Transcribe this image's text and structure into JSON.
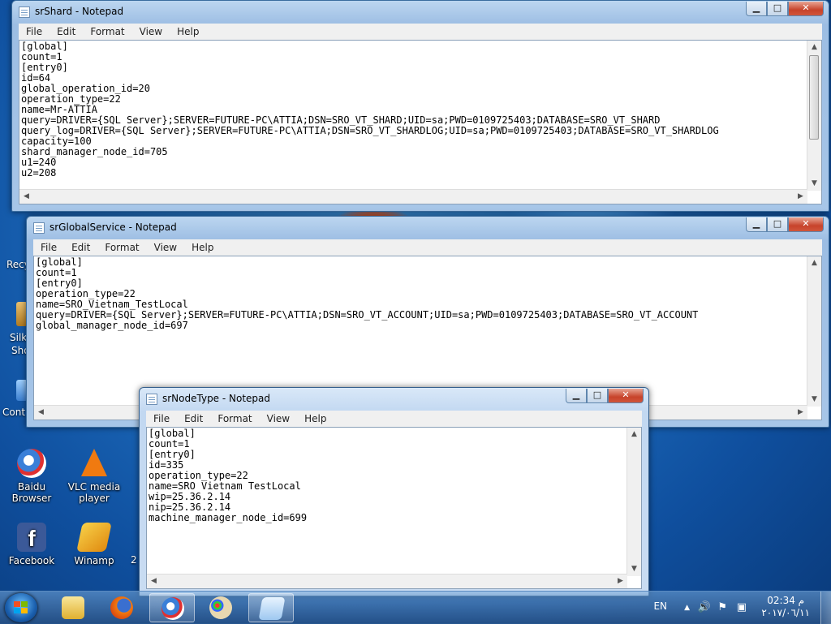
{
  "desktop": {
    "icons": [
      {
        "label": "Baidu Browser",
        "line1": "Baidu",
        "line2": "Browser",
        "icon": "baidu-browser-icon"
      },
      {
        "label": "VLC media player",
        "line1": "VLC media",
        "line2": "player",
        "icon": "vlc-icon"
      },
      {
        "label": "Facebook",
        "line1": "Facebook",
        "line2": "",
        "icon": "facebook-icon"
      },
      {
        "label": "Winamp",
        "line1": "Winamp",
        "line2": "",
        "icon": "winamp-icon"
      }
    ],
    "partial_labels": {
      "recycle": "Recy",
      "silk1": "Silk",
      "silk2": "Sho",
      "control": "Cont",
      "two": "2"
    }
  },
  "menu": [
    "File",
    "Edit",
    "Format",
    "View",
    "Help"
  ],
  "windows": {
    "shard": {
      "title": "srShard - Notepad",
      "content": "[global]\ncount=1\n[entry0]\nid=64\nglobal_operation_id=20\noperation_type=22\nname=Mr-ATTIA\nquery=DRIVER={SQL Server};SERVER=FUTURE-PC\\ATTIA;DSN=SRO_VT_SHARD;UID=sa;PWD=0109725403;DATABASE=SRO_VT_SHARD\nquery_log=DRIVER={SQL Server};SERVER=FUTURE-PC\\ATTIA;DSN=SRO_VT_SHARDLOG;UID=sa;PWD=0109725403;DATABASE=SRO_VT_SHARDLOG\ncapacity=100\nshard_manager_node_id=705\nu1=240\nu2=208"
    },
    "global": {
      "title": "srGlobalService - Notepad",
      "content": "[global]\ncount=1\n[entry0]\noperation_type=22\nname=SRO_Vietnam_TestLocal\nquery=DRIVER={SQL Server};SERVER=FUTURE-PC\\ATTIA;DSN=SRO_VT_ACCOUNT;UID=sa;PWD=0109725403;DATABASE=SRO_VT_ACCOUNT\nglobal_manager_node_id=697"
    },
    "node": {
      "title": "srNodeType - Notepad",
      "content": "[global]\ncount=1\n[entry0]\nid=335\noperation_type=22\nname=SRO Vietnam TestLocal\nwip=25.36.2.14\nnip=25.36.2.14\nmachine_manager_node_id=699"
    }
  },
  "window_buttons": {
    "minimize": "▁",
    "maximize": "□",
    "close": "✕"
  },
  "taskbar": {
    "apps": [
      "explorer-icon",
      "firefox-icon",
      "baidu-browser-icon",
      "paint-icon",
      "notepad-icon"
    ],
    "language": "EN",
    "time": "02:34 م",
    "date": "٢٠١٧/٠٦/١١"
  }
}
